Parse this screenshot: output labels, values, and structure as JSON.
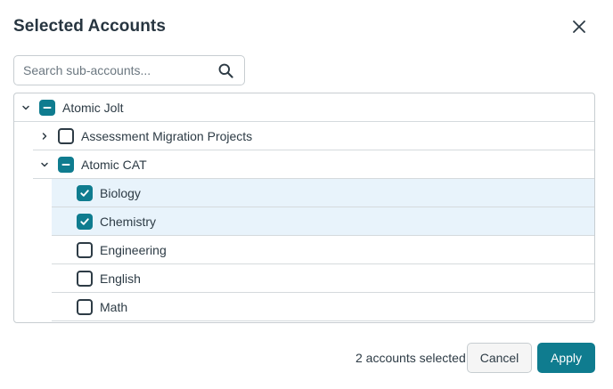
{
  "dialog": {
    "title": "Selected Accounts"
  },
  "search": {
    "placeholder": "Search sub-accounts..."
  },
  "tree": {
    "rows": [
      {
        "label": "Atomic Jolt",
        "state": "partial",
        "expander": "expanded",
        "selected": false
      },
      {
        "label": "Assessment Migration Projects",
        "state": "unchecked",
        "expander": "collapsed",
        "selected": false
      },
      {
        "label": "Atomic CAT",
        "state": "partial",
        "expander": "expanded",
        "selected": false
      },
      {
        "label": "Biology",
        "state": "checked",
        "expander": "none",
        "selected": true
      },
      {
        "label": "Chemistry",
        "state": "checked",
        "expander": "none",
        "selected": true
      },
      {
        "label": "Engineering",
        "state": "unchecked",
        "expander": "none",
        "selected": false
      },
      {
        "label": "English",
        "state": "unchecked",
        "expander": "none",
        "selected": false
      },
      {
        "label": "Math",
        "state": "unchecked",
        "expander": "none",
        "selected": false
      }
    ]
  },
  "footer": {
    "selected_count_text": "2 accounts selected",
    "cancel_label": "Cancel",
    "apply_label": "Apply"
  },
  "colors": {
    "accent": "#0f7c8f",
    "selected_row_bg": "#e8f3fb"
  },
  "icons": {
    "close": "close-icon",
    "search": "search-icon",
    "expanded": "chevron-down-icon",
    "collapsed": "chevron-right-icon"
  }
}
